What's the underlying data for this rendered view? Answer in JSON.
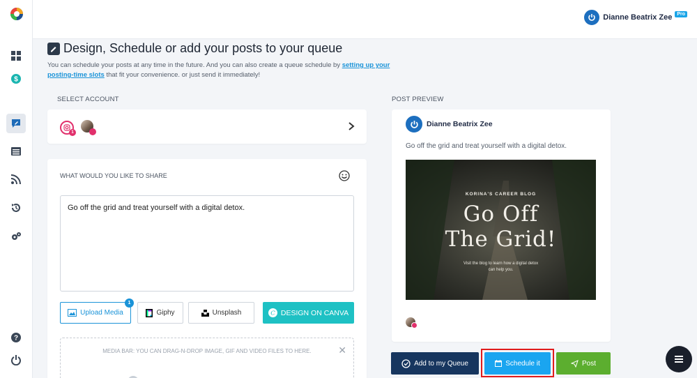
{
  "brand": {
    "accent": "#1a93d8",
    "canva_color": "#1ec1c4",
    "queue_color": "#17365f",
    "schedule_color": "#1aa5f0",
    "post_color": "#5cae2f"
  },
  "sidebar": {
    "items": [
      {
        "name": "dashboard",
        "icon": "grid-icon"
      },
      {
        "name": "billing",
        "icon": "dollar-icon"
      },
      {
        "name": "compose",
        "icon": "compose-icon",
        "active": true
      },
      {
        "name": "queue",
        "icon": "list-icon"
      },
      {
        "name": "feeds",
        "icon": "rss-icon"
      },
      {
        "name": "history",
        "icon": "history-icon"
      },
      {
        "name": "settings",
        "icon": "gears-icon"
      },
      {
        "name": "help",
        "icon": "help-icon"
      },
      {
        "name": "logout",
        "icon": "power-icon"
      }
    ]
  },
  "topbar": {
    "user_name": "Dianne Beatrix Zee",
    "plan_badge": "Pro"
  },
  "header": {
    "title": "Design, Schedule or add your posts to your queue",
    "subtitle_before": "You can schedule your posts at any time in the future. And you can also create a queue schedule by ",
    "subtitle_link": "setting up your posting-time slots",
    "subtitle_after": " that fit your convenience. or just send it immediately!"
  },
  "select_account": {
    "label": "SELECT ACCOUNT",
    "instagram_badge_count": "1"
  },
  "composer": {
    "label": "WHAT WOULD YOU LIKE TO SHARE",
    "text": "Go off the grid and treat yourself with a digital detox.",
    "buttons": {
      "upload": "Upload Media",
      "upload_count": "1",
      "giphy": "Giphy",
      "unsplash": "Unsplash",
      "canva": "DESIGN ON CANVA"
    },
    "media_bar_text": "MEDIA BAR: YOU CAN DRAG-N-DROP IMAGE, GIF AND VIDEO FILES TO HERE.",
    "media_bar_close": "✕"
  },
  "preview": {
    "label": "POST PREVIEW",
    "user_name": "Dianne Beatrix Zee",
    "text": "Go off the grid and treat yourself with a digital detox.",
    "image": {
      "blog_name": "KORINA'S CAREER BLOG",
      "headline_line1": "Go Off",
      "headline_line2": "The Grid!",
      "caption_line1": "Visit the blog to learn how a digital detox",
      "caption_line2": "can help you."
    }
  },
  "actions": {
    "queue": "Add to my Queue",
    "schedule": "Schedule it",
    "post": "Post"
  }
}
